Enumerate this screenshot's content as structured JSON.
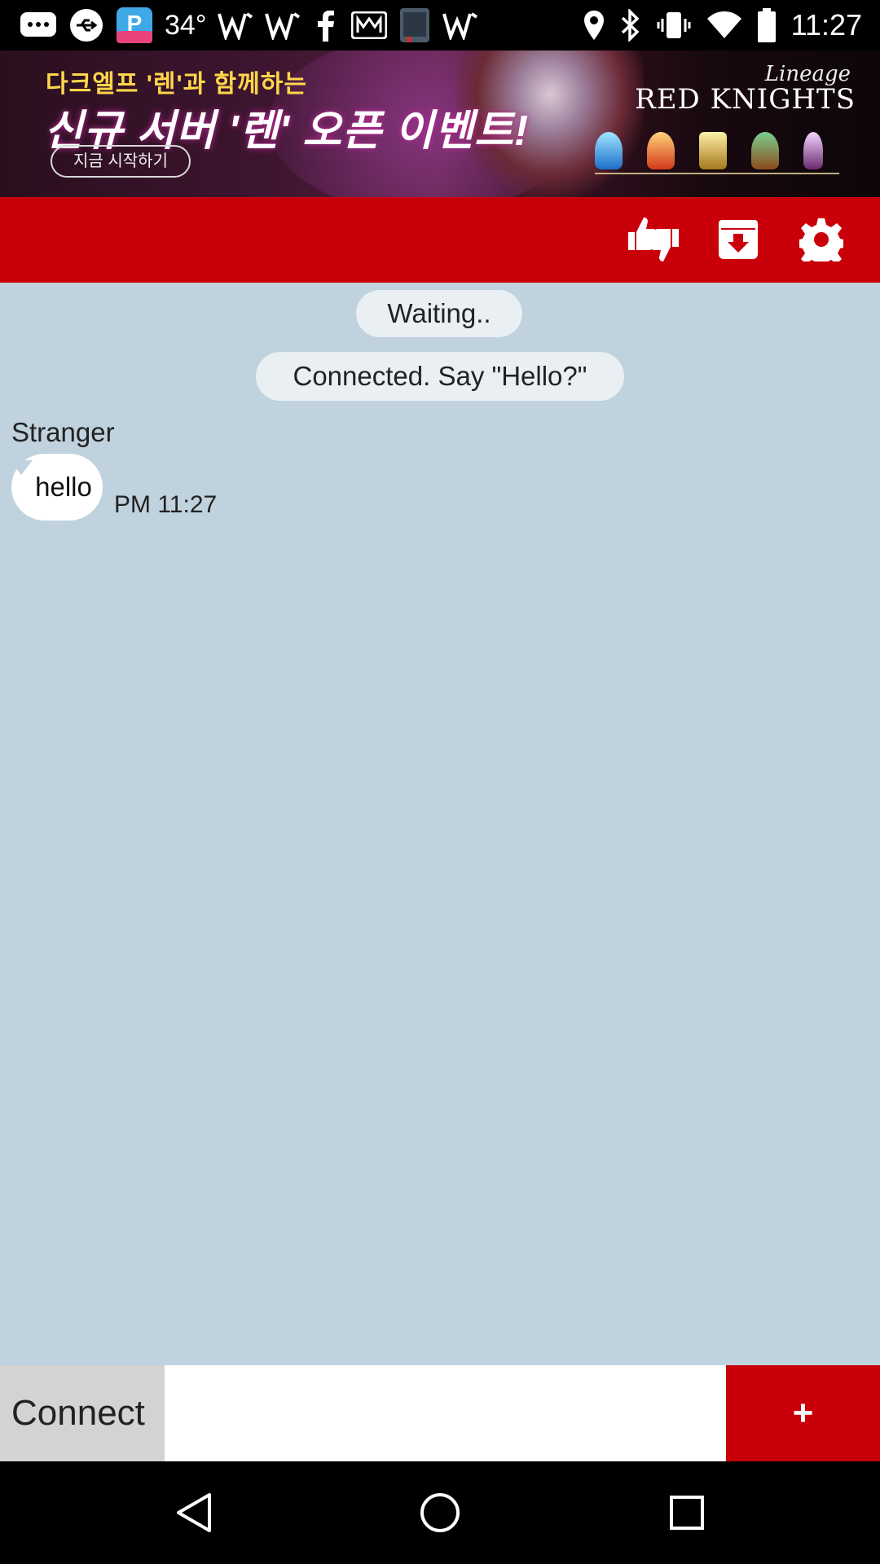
{
  "status_bar": {
    "temperature": "34°",
    "time": "11:27",
    "icons": [
      "messaging-icon",
      "usb-icon",
      "p-app-icon",
      "temperature-text",
      "signal-w-icon",
      "signal-w-icon",
      "facebook-icon",
      "m-app-icon",
      "holy-bible-icon",
      "signal-w-icon",
      "location-icon",
      "bluetooth-icon",
      "vibrate-icon",
      "wifi-icon",
      "battery-icon"
    ]
  },
  "ad": {
    "line1": "다크엘프 '렌'과 함께하는",
    "line2": "신규 서버 '렌' 오픈 이벤트!",
    "cta": "지금 시작하기",
    "brand_top": "Lineage",
    "brand": "RED KNIGHTS"
  },
  "toolbar": {
    "icons": [
      "thumbs-up-down-icon",
      "download-box-icon",
      "gear-icon"
    ],
    "color": "#c9000a"
  },
  "chat": {
    "background": "#bfd2de",
    "system_messages": [
      "Waiting..",
      "Connected. Say \"Hello?\""
    ],
    "messages": [
      {
        "sender": "Stranger",
        "text": "hello",
        "time": "PM 11:27"
      }
    ]
  },
  "input_bar": {
    "connect_label": "Connect",
    "message_value": "",
    "plus_label": "+"
  },
  "nav_bar": {
    "icons": [
      "back-icon",
      "home-icon",
      "recent-apps-icon"
    ]
  }
}
